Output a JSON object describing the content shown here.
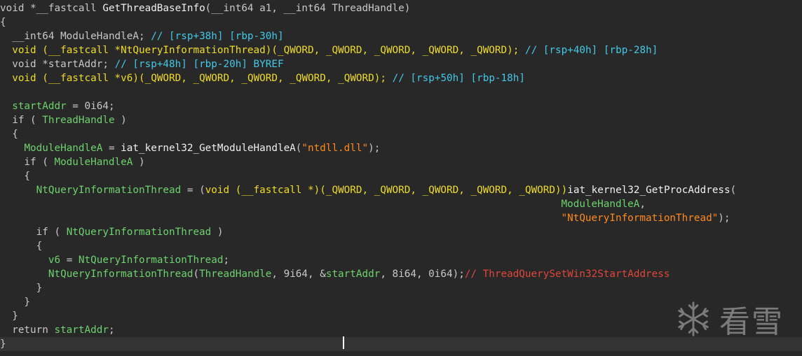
{
  "code": {
    "l1": {
      "a": "void",
      "b": " *__fastcall ",
      "c": "GetThreadBaseInfo",
      "d": "(__int64 a1, __int64 ThreadHandle)"
    },
    "l2": {
      "a": "{"
    },
    "l3": {
      "a": "  __int64 ",
      "b": "ModuleHandleA",
      "c": "; ",
      "d": "// [rsp+38h] [rbp-30h]"
    },
    "l4": {
      "a": "  void (",
      "b": "__fastcall",
      "c": " *",
      "d": "NtQueryInformationThread",
      "e": ")(",
      "f": "_QWORD",
      "g": ", ",
      "h": "_QWORD",
      "i": ", ",
      "j": "_QWORD",
      "k": ", ",
      "l": "_QWORD",
      "m": ", ",
      "n": "_QWORD",
      "o": "); ",
      "p": "// [rsp+40h] [rbp-28h]"
    },
    "l5": {
      "a": "  void *",
      "b": "startAddr",
      "c": "; ",
      "d": "// [rsp+48h] [rbp-20h] BYREF"
    },
    "l6": {
      "a": "  void (",
      "b": "__fastcall",
      "c": " *",
      "d": "v6",
      "e": ")(",
      "f": "_QWORD",
      "g": ", ",
      "h": "_QWORD",
      "i": ", ",
      "j": "_QWORD",
      "k": ", ",
      "l": "_QWORD",
      "m": ", ",
      "n": "_QWORD",
      "o": "); ",
      "p": "// [rsp+50h] [rbp-18h]"
    },
    "l8": {
      "a": "  ",
      "b": "startAddr",
      "c": " = 0i64;"
    },
    "l9": {
      "a": "  if ( ",
      "b": "ThreadHandle",
      "c": " )"
    },
    "l10": {
      "a": "  {"
    },
    "l11": {
      "a": "    ",
      "b": "ModuleHandleA",
      "c": " = ",
      "d": "iat_kernel32_GetModuleHandleA",
      "e": "(",
      "f": "\"ntdll.dll\"",
      "g": ");"
    },
    "l12": {
      "a": "    if ( ",
      "b": "ModuleHandleA",
      "c": " )"
    },
    "l13": {
      "a": "    {"
    },
    "l14": {
      "a": "      ",
      "b": "NtQueryInformationThread",
      "c": " = (",
      "d": "void (",
      "e": "__fastcall",
      "f": " *)(",
      "g": "_QWORD",
      "h": ", ",
      "i": "_QWORD",
      "j": ", ",
      "k": "_QWORD",
      "l": ", ",
      "m": "_QWORD",
      "n": ", ",
      "o": "_QWORD",
      "p": "))",
      "q": "iat_kernel32_GetProcAddress",
      "r": "("
    },
    "l15": {
      "a": "                                                                                             ",
      "b": "ModuleHandleA",
      "c": ","
    },
    "l16": {
      "a": "                                                                                             ",
      "b": "\"NtQueryInformationThread\"",
      "c": ");"
    },
    "l18": {
      "a": "      if ( ",
      "b": "NtQueryInformationThread",
      "c": " )"
    },
    "l19": {
      "a": "      {"
    },
    "l20": {
      "a": "        ",
      "b": "v6",
      "c": " = ",
      "d": "NtQueryInformationThread",
      "e": ";"
    },
    "l21": {
      "a": "        ",
      "b": "NtQueryInformationThread",
      "c": "(",
      "d": "ThreadHandle",
      "e": ", 9i64, &",
      "f": "startAddr",
      "g": ", 8i64, 0i64);",
      "h": "// ThreadQuerySetWin32StartAddress"
    },
    "l22": {
      "a": "      }"
    },
    "l23": {
      "a": "    }"
    },
    "l24": {
      "a": "  }"
    },
    "l25": {
      "a": "  return ",
      "b": "startAddr",
      "c": ";"
    },
    "l26": {
      "a": "}"
    }
  },
  "watermark": {
    "text": "看雪",
    "icon": "snowflake-icon"
  },
  "colors": {
    "background": "#282828",
    "keyword": "#f0dc28",
    "variable": "#6ed26e",
    "comment": "#43c8e6",
    "string": "#ff8a1e",
    "red_comment": "#e0463c"
  }
}
